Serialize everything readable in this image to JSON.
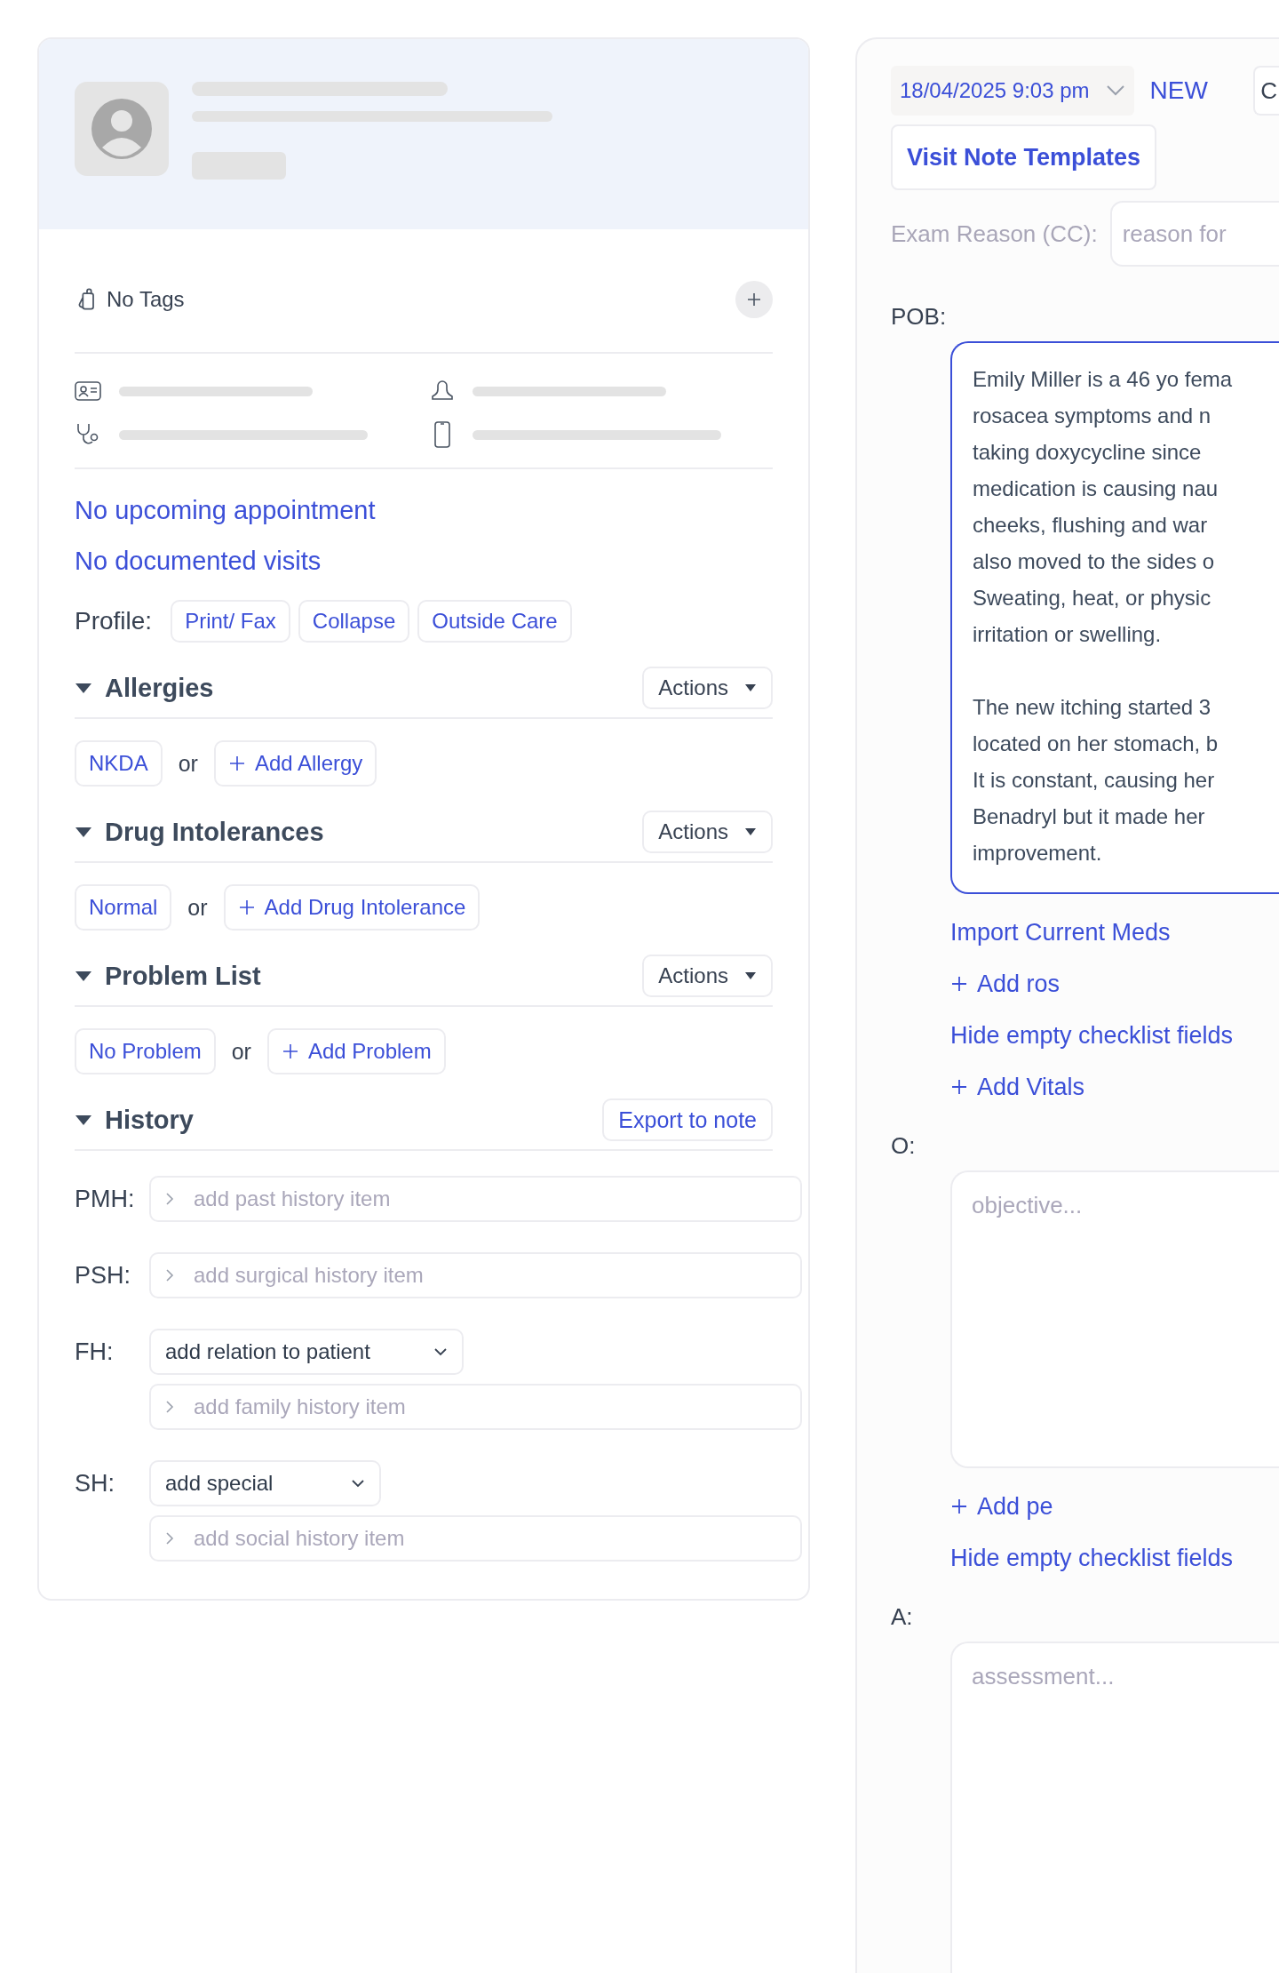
{
  "patient_card": {
    "tags": {
      "label": "No Tags"
    },
    "links": [
      "No upcoming appointment",
      "No documented visits"
    ],
    "profile": {
      "label": "Profile:",
      "buttons": [
        "Print/ Fax",
        "Collapse",
        "Outside Care"
      ]
    },
    "sections": [
      {
        "title": "Allergies",
        "action": {
          "kind": "menu",
          "label": "Actions"
        },
        "default_chip": "NKDA",
        "separator": "or",
        "add_button": "Add Allergy"
      },
      {
        "title": "Drug Intolerances",
        "action": {
          "kind": "menu",
          "label": "Actions"
        },
        "default_chip": "Normal",
        "separator": "or",
        "add_button": "Add Drug Intolerance"
      },
      {
        "title": "Problem List",
        "action": {
          "kind": "menu",
          "label": "Actions"
        },
        "default_chip": "No Problem",
        "separator": "or",
        "add_button": "Add Problem"
      },
      {
        "title": "History",
        "action": {
          "kind": "link",
          "label": "Export to note"
        }
      }
    ],
    "history": [
      {
        "label": "PMH:",
        "placeholder": "add past history item"
      },
      {
        "label": "PSH:",
        "placeholder": "add surgical history item"
      },
      {
        "label": "FH:",
        "select": "add relation to patient",
        "placeholder": "add family history item"
      },
      {
        "label": "SH:",
        "select": "add special",
        "placeholder": "add social history item"
      }
    ]
  },
  "visit_note": {
    "date": "18/04/2025 9:03 pm",
    "status": "NEW",
    "cut_button": "C",
    "templates_button": "Visit Note Templates",
    "exam_reason": {
      "label": "Exam Reason (CC):",
      "placeholder": "reason for"
    },
    "pob": {
      "label": "POB:",
      "paragraphs": [
        "Emily Miller is a 46 yo fema\nrosacea symptoms and n\ntaking doxycycline since\nmedication is causing nau\ncheeks, flushing and war\nalso moved to the sides o\nSweating, heat, or physic\nirritation or swelling.",
        "The new itching started 3\nlocated on her stomach, b\nIt is constant, causing her\nBenadryl but it made her\nimprovement."
      ]
    },
    "pob_links": [
      {
        "kind": "link",
        "label": "Import Current Meds"
      },
      {
        "kind": "add",
        "label": "Add ros"
      },
      {
        "kind": "link",
        "label": "Hide empty checklist fields"
      },
      {
        "kind": "add",
        "label": "Add Vitals"
      }
    ],
    "objective": {
      "label": "O:",
      "placeholder": "objective..."
    },
    "objective_links": [
      {
        "kind": "add",
        "label": "Add pe"
      },
      {
        "kind": "link",
        "label": "Hide empty checklist fields"
      }
    ],
    "assessment": {
      "label": "A:",
      "placeholder": "assessment..."
    }
  }
}
